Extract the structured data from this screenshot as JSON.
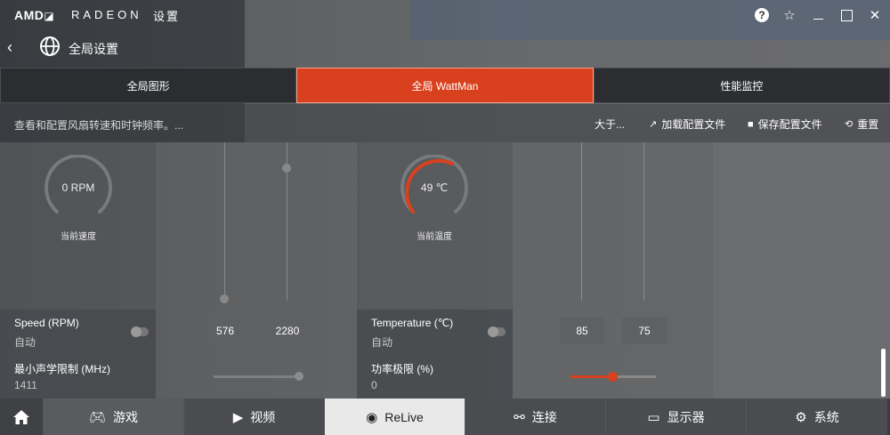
{
  "titlebar": {
    "logo": "AMD",
    "brand": "RADEON",
    "brand_sub": "设置",
    "help_glyph": "?",
    "star_glyph": "☆",
    "close_glyph": "✕"
  },
  "nav": {
    "back_glyph": "‹",
    "title": "全局设置"
  },
  "tabs": [
    {
      "label": "全局图形"
    },
    {
      "label": "全局 WattMan"
    },
    {
      "label": "性能监控"
    }
  ],
  "actionbar": {
    "description": "查看和配置风扇转速和时钟频率。...",
    "about": "大于...",
    "load": "加载配置文件",
    "save": "保存配置文件",
    "reset": "重置"
  },
  "fan": {
    "gauge_value": "0 RPM",
    "gauge_caption": "当前速度",
    "speed_label": "Speed (RPM)",
    "speed_mode": "自动",
    "min_val": "576",
    "max_val": "2280",
    "acoustic_label": "最小声学限制 (MHz)",
    "acoustic_value": "1411"
  },
  "temp": {
    "gauge_value": "49 ℃",
    "gauge_caption": "当前温度",
    "temp_label": "Temperature (℃)",
    "temp_mode": "自动",
    "max_val": "85",
    "target_val": "75",
    "power_label": "功率极限 (%)",
    "power_value": "0"
  },
  "bottom_nav": [
    {
      "label": "游戏"
    },
    {
      "label": "视频"
    },
    {
      "label": "ReLive"
    },
    {
      "label": "连接"
    },
    {
      "label": "显示器"
    },
    {
      "label": "系统"
    }
  ],
  "colors": {
    "accent": "#d9411e"
  }
}
